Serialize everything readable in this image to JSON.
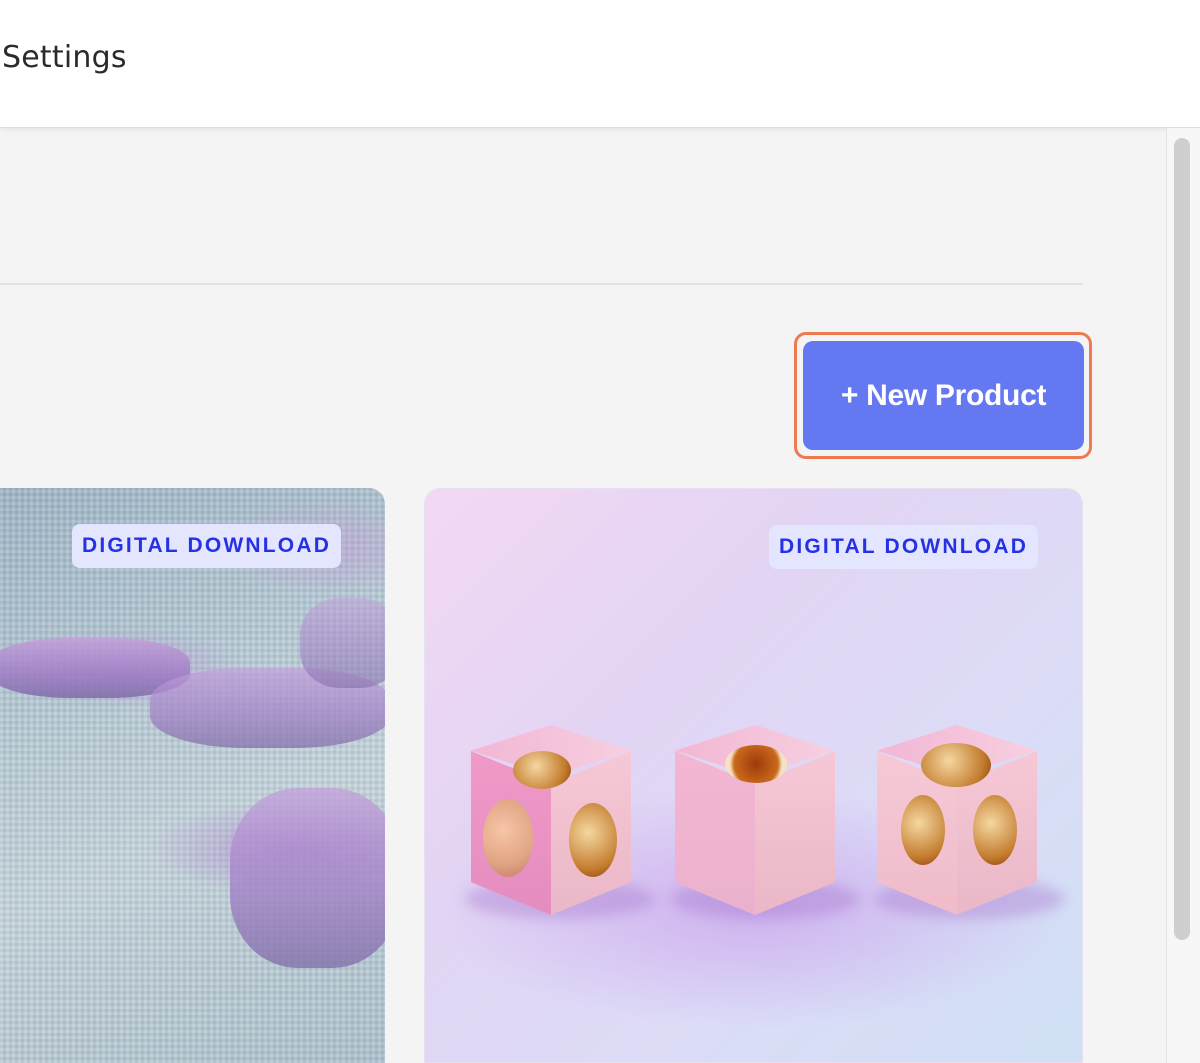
{
  "header": {
    "title": "Settings"
  },
  "toolbar": {
    "new_product_label": "+ New Product"
  },
  "products": [
    {
      "badge": "DIGITAL DOWNLOAD",
      "image": "pixel-landscape-art"
    },
    {
      "badge": "DIGITAL DOWNLOAD",
      "image": "pink-cubes-art"
    }
  ],
  "colors": {
    "accent": "#6478f2",
    "highlight": "#ee7a4f",
    "badge_text": "#2631e4",
    "badge_bg": "#e4e6ff"
  }
}
